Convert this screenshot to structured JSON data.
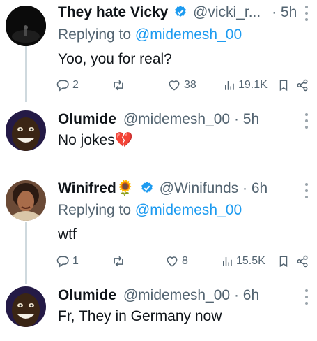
{
  "tweets": [
    {
      "display_name": "They hate Vicky",
      "handle": "@vicki_r...",
      "time": "· 5h",
      "replying_prefix": "Replying to",
      "replying_to": "@midemesh_00",
      "text": "Yoo, you for real?",
      "verified": true,
      "stats": {
        "replies": "2",
        "retweets": "",
        "likes": "38",
        "views": "19.1K"
      }
    },
    {
      "display_name": "Olumide",
      "handle": "@midemesh_00",
      "time": "· 5h",
      "text": "No jokes💔",
      "verified": false
    },
    {
      "display_name": "Winifred🌻",
      "handle": "@Winifunds",
      "time": "· 6h",
      "replying_prefix": "Replying to",
      "replying_to": "@midemesh_00",
      "text": "wtf",
      "verified": true,
      "stats": {
        "replies": "1",
        "retweets": "",
        "likes": "8",
        "views": "15.5K"
      }
    },
    {
      "display_name": "Olumide",
      "handle": "@midemesh_00",
      "time": "· 6h",
      "text": "Fr, They in Germany now",
      "verified": false
    }
  ],
  "colors": {
    "accent": "#1d9bf0",
    "muted": "#536471",
    "thread_line": "#cfd9de",
    "text": "#0f1419"
  },
  "icons": [
    "reply-icon",
    "retweet-icon",
    "like-icon",
    "views-icon",
    "bookmark-icon",
    "share-icon",
    "more-icon",
    "verified-badge-icon"
  ]
}
